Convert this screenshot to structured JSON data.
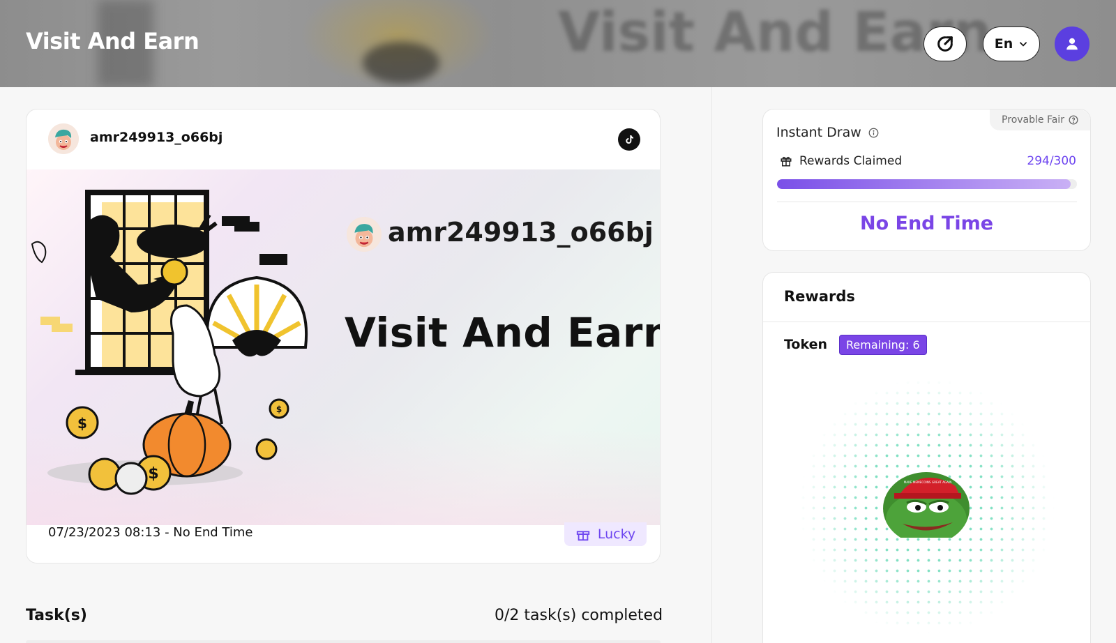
{
  "header": {
    "title": "Visit And Earn",
    "lang": "En"
  },
  "event": {
    "username": "amr249913_o66bj",
    "banner_username": "amr249913_o66bj",
    "banner_title": "Visit And Earn",
    "dates": "07/23/2023 08:13 - No End Time",
    "badge": "Lucky"
  },
  "tasks": {
    "title": "Task(s)",
    "progress": "0/2 task(s) completed"
  },
  "draw": {
    "provable": "Provable Fair",
    "title": "Instant Draw",
    "claimed_label": "Rewards Claimed",
    "claimed_value": "294/300",
    "claimed_fraction": 0.98,
    "end_time": "No End Time"
  },
  "rewards": {
    "title": "Rewards",
    "token_label": "Token",
    "remaining": "Remaining: 6",
    "token_cap_text": "MAKE MEMECOINS GREAT AGAIN"
  },
  "colors": {
    "accent": "#7a45e6",
    "user_button": "#5b3fe0"
  }
}
